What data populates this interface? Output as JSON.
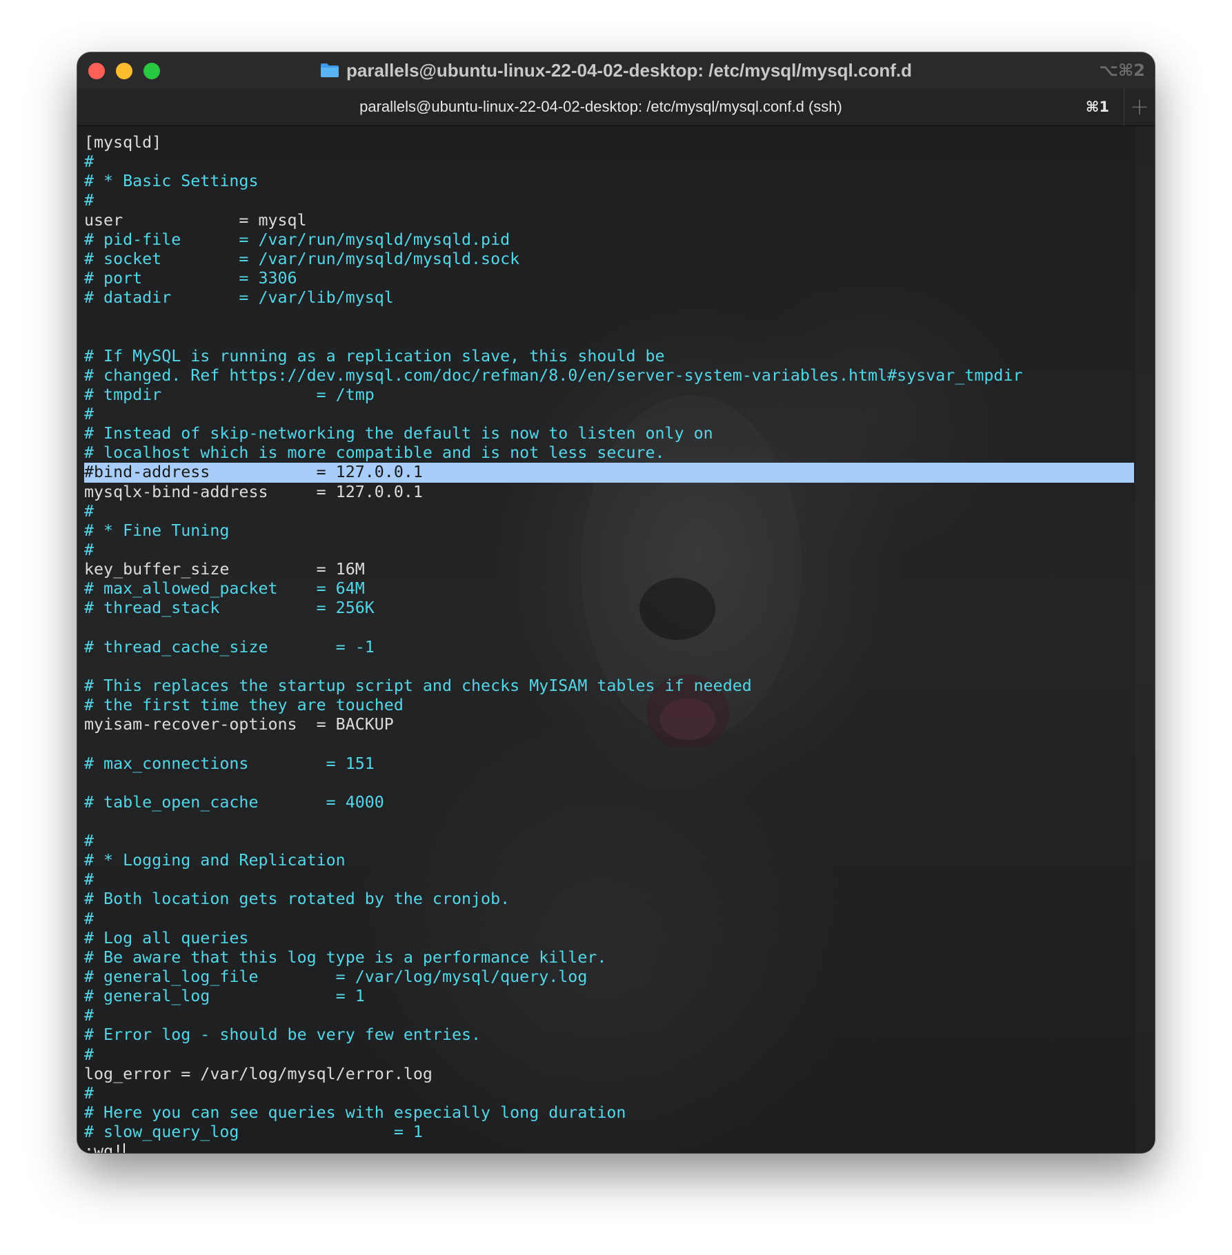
{
  "window": {
    "title": "parallels@ubuntu-linux-22-04-02-desktop: /etc/mysql/mysql.conf.d",
    "shortcut": "⌥⌘2"
  },
  "tab": {
    "label": "parallels@ubuntu-linux-22-04-02-desktop: /etc/mysql/mysql.conf.d (ssh)",
    "shortcut": "⌘1",
    "new_tab": "+"
  },
  "editor": {
    "lines": [
      {
        "text": "[mysqld]",
        "kind": "plain"
      },
      {
        "text": "#",
        "kind": "comment"
      },
      {
        "text": "# * Basic Settings",
        "kind": "comment"
      },
      {
        "text": "#",
        "kind": "comment"
      },
      {
        "text": "user            = mysql",
        "kind": "plain"
      },
      {
        "text": "# pid-file      = /var/run/mysqld/mysqld.pid",
        "kind": "comment"
      },
      {
        "text": "# socket        = /var/run/mysqld/mysqld.sock",
        "kind": "comment"
      },
      {
        "text": "# port          = 3306",
        "kind": "comment"
      },
      {
        "text": "# datadir       = /var/lib/mysql",
        "kind": "comment"
      },
      {
        "text": "",
        "kind": "plain"
      },
      {
        "text": "",
        "kind": "plain"
      },
      {
        "text": "# If MySQL is running as a replication slave, this should be",
        "kind": "comment"
      },
      {
        "text": "# changed. Ref https://dev.mysql.com/doc/refman/8.0/en/server-system-variables.html#sysvar_tmpdir",
        "kind": "comment"
      },
      {
        "text": "# tmpdir                = /tmp",
        "kind": "comment"
      },
      {
        "text": "#",
        "kind": "comment"
      },
      {
        "text": "# Instead of skip-networking the default is now to listen only on",
        "kind": "comment"
      },
      {
        "text": "# localhost which is more compatible and is not less secure.",
        "kind": "comment"
      },
      {
        "text": "#bind-address           = 127.0.0.1",
        "kind": "highlight"
      },
      {
        "text": "mysqlx-bind-address     = 127.0.0.1",
        "kind": "plain"
      },
      {
        "text": "#",
        "kind": "comment"
      },
      {
        "text": "# * Fine Tuning",
        "kind": "comment"
      },
      {
        "text": "#",
        "kind": "comment"
      },
      {
        "text": "key_buffer_size         = 16M",
        "kind": "plain"
      },
      {
        "text": "# max_allowed_packet    = 64M",
        "kind": "comment"
      },
      {
        "text": "# thread_stack          = 256K",
        "kind": "comment"
      },
      {
        "text": "",
        "kind": "plain"
      },
      {
        "text": "# thread_cache_size       = -1",
        "kind": "comment"
      },
      {
        "text": "",
        "kind": "plain"
      },
      {
        "text": "# This replaces the startup script and checks MyISAM tables if needed",
        "kind": "comment"
      },
      {
        "text": "# the first time they are touched",
        "kind": "comment"
      },
      {
        "text": "myisam-recover-options  = BACKUP",
        "kind": "plain"
      },
      {
        "text": "",
        "kind": "plain"
      },
      {
        "text": "# max_connections        = 151",
        "kind": "comment"
      },
      {
        "text": "",
        "kind": "plain"
      },
      {
        "text": "# table_open_cache       = 4000",
        "kind": "comment"
      },
      {
        "text": "",
        "kind": "plain"
      },
      {
        "text": "#",
        "kind": "comment"
      },
      {
        "text": "# * Logging and Replication",
        "kind": "comment"
      },
      {
        "text": "#",
        "kind": "comment"
      },
      {
        "text": "# Both location gets rotated by the cronjob.",
        "kind": "comment"
      },
      {
        "text": "#",
        "kind": "comment"
      },
      {
        "text": "# Log all queries",
        "kind": "comment"
      },
      {
        "text": "# Be aware that this log type is a performance killer.",
        "kind": "comment"
      },
      {
        "text": "# general_log_file        = /var/log/mysql/query.log",
        "kind": "comment"
      },
      {
        "text": "# general_log             = 1",
        "kind": "comment"
      },
      {
        "text": "#",
        "kind": "comment"
      },
      {
        "text": "# Error log - should be very few entries.",
        "kind": "comment"
      },
      {
        "text": "#",
        "kind": "comment"
      },
      {
        "text": "log_error = /var/log/mysql/error.log",
        "kind": "plain"
      },
      {
        "text": "#",
        "kind": "comment"
      },
      {
        "text": "# Here you can see queries with especially long duration",
        "kind": "comment"
      },
      {
        "text": "# slow_query_log                = 1",
        "kind": "comment"
      }
    ],
    "command_line": ":wq!"
  },
  "colors": {
    "comment": "#53d6e8",
    "plain": "#dcdcdc",
    "highlight": "#a9cdfa"
  }
}
